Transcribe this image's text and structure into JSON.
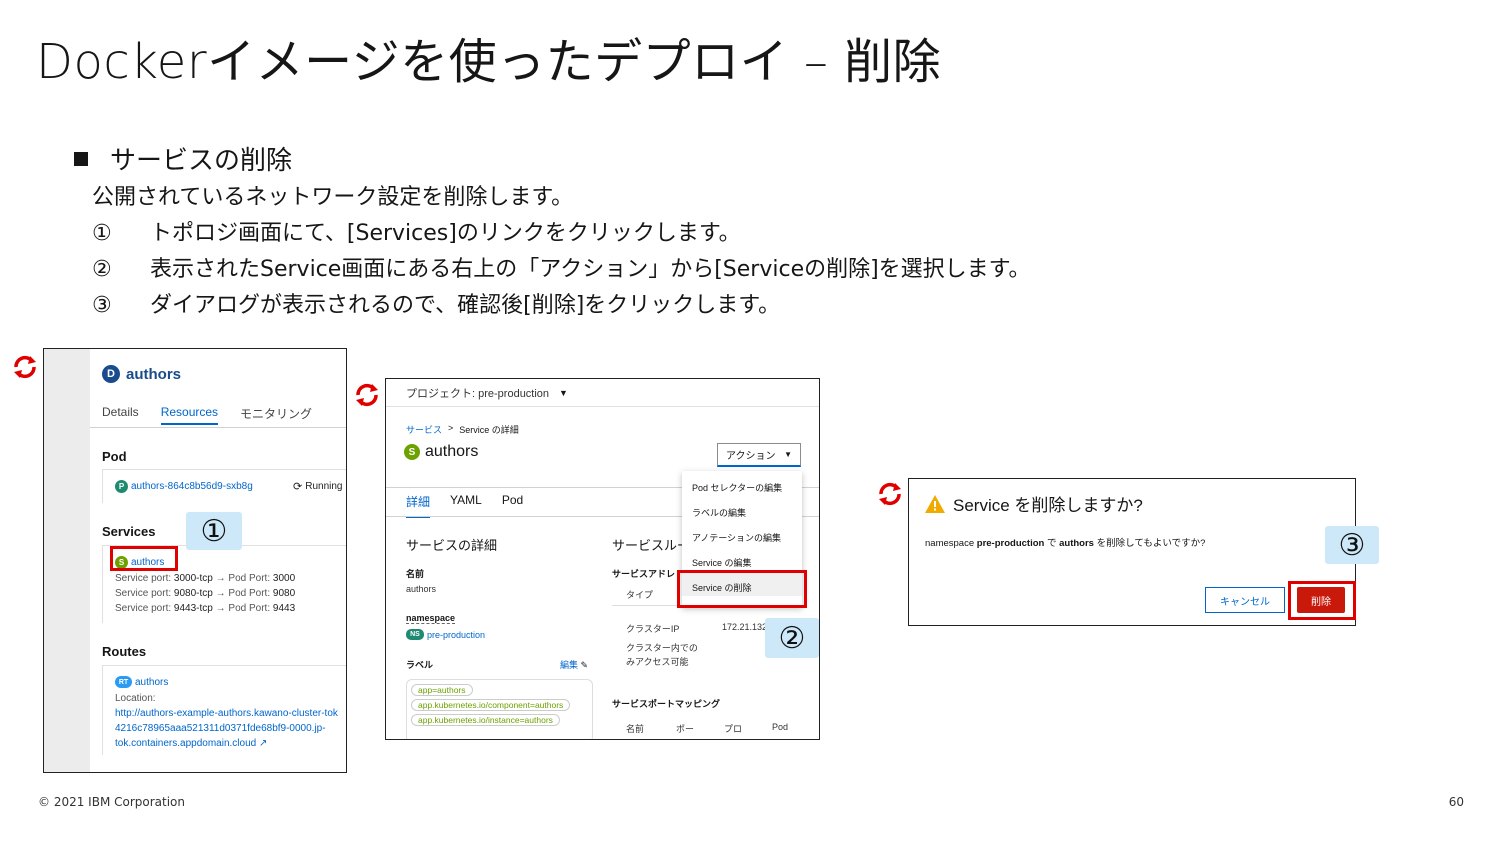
{
  "slide": {
    "title": "Dockerイメージを使ったデプロイ – 削除",
    "section": "サービスの削除",
    "lines": [
      {
        "num": "",
        "text": "公開されているネットワーク設定を削除します。"
      },
      {
        "num": "①",
        "text": "トポロジ画面にて、[Services]のリンクをクリックします。"
      },
      {
        "num": "②",
        "text": "表示されたService画面にある右上の「アクション」から[Serviceの削除]を選択します。"
      },
      {
        "num": "③",
        "text": "ダイアログが表示されるので、確認後[削除]をクリックします。"
      }
    ],
    "footer_copyright": "© 2021 IBM Corporation",
    "page_number": "60"
  },
  "colors": {
    "redbox": "#e00000",
    "callout": "#cde8f9",
    "link": "#0066cc",
    "danger": "#c9190b",
    "sync": "#e00000"
  },
  "panel1": {
    "badge": "D",
    "name": "authors",
    "tabs": [
      "Details",
      "Resources",
      "モニタリング"
    ],
    "pod_heading": "Pod",
    "pod_badge": "P",
    "pod_name": "authors-864c8b56d9-sxb8g",
    "pod_status": "Running",
    "services_heading": "Services",
    "svc_badge": "S",
    "svc_name": "authors",
    "ports": [
      {
        "label": "Service port:",
        "port": "3000-tcp",
        "arrow": "→",
        "pod_label": "Pod Port:",
        "pod_port": "3000"
      },
      {
        "label": "Service port:",
        "port": "9080-tcp",
        "arrow": "→",
        "pod_label": "Pod Port:",
        "pod_port": "9080"
      },
      {
        "label": "Service port:",
        "port": "9443-tcp",
        "arrow": "→",
        "pod_label": "Pod Port:",
        "pod_port": "9443"
      }
    ],
    "routes_heading": "Routes",
    "route_badge": "RT",
    "route_name": "authors",
    "location_label": "Location:",
    "location_url_1": "http://authors-example-authors.kawano-cluster-tok",
    "location_url_2": "4216c78965aaa521311d0371fde68bf9-0000.jp-",
    "location_url_3": "tok.containers.appdomain.cloud",
    "callout": "①"
  },
  "panel2": {
    "project": "プロジェクト: pre-production",
    "breadcrumb_1": "サービス",
    "breadcrumb_sep": ">",
    "breadcrumb_2": "Service の詳細",
    "badge": "S",
    "name": "authors",
    "action_button": "アクション",
    "menu": [
      "Pod セレクターの編集",
      "ラベルの編集",
      "アノテーションの編集",
      "Service の編集",
      "Service の削除"
    ],
    "tabs": [
      "詳細",
      "YAML",
      "Pod"
    ],
    "details_heading": "サービスの詳細",
    "routing_heading": "サービスルー",
    "name_label": "名前",
    "name_value": "authors",
    "ns_label": "namespace",
    "ns_badge": "NS",
    "ns_value": "pre-production",
    "labels_label": "ラベル",
    "edit_label": "編集",
    "labels": [
      "app=authors",
      "app.kubernetes.io/component=authors",
      "app.kubernetes.io/instance=authors"
    ],
    "addr_label": "サービスアドレ",
    "type_label": "タイプ",
    "cluster_ip_label": "クラスターIP",
    "cluster_ip_value": "172.21.132",
    "cluster_internal_1": "クラスター内での",
    "cluster_internal_2": "みアクセス可能",
    "port_mapping": "サービスポートマッピング",
    "col_name": "名前",
    "col_port": "ポー",
    "col_proto": "プロ",
    "col_pod": "Pod",
    "callout": "②"
  },
  "panel3": {
    "title": "Service を削除しますか?",
    "msg_1": "namespace",
    "msg_ns": "pre-production",
    "msg_2": "で",
    "msg_name": "authors",
    "msg_3": "を削除してもよいですか?",
    "cancel": "キャンセル",
    "delete": "削除",
    "callout": "③"
  }
}
